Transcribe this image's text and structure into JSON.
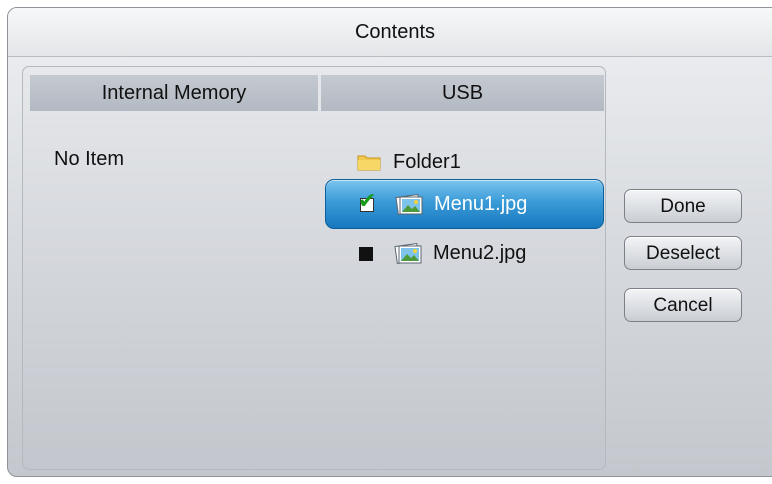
{
  "dialog": {
    "title": "Contents"
  },
  "columns": {
    "left_header": "Internal Memory",
    "right_header": "USB"
  },
  "internal_memory": {
    "empty_text": "No Item"
  },
  "usb": {
    "folder": {
      "label": "Folder1",
      "icon": "folder-icon"
    },
    "files": [
      {
        "label": "Menu1.jpg",
        "icon": "image-file-icon",
        "checked": true,
        "selected": true
      },
      {
        "label": "Menu2.jpg",
        "icon": "image-file-icon",
        "checked": false,
        "selected": false
      }
    ]
  },
  "buttons": {
    "done": "Done",
    "deselect": "Deselect",
    "cancel": "Cancel"
  },
  "colors": {
    "selection": "#3a9bd8",
    "checkmark": "#1a9a1a"
  }
}
